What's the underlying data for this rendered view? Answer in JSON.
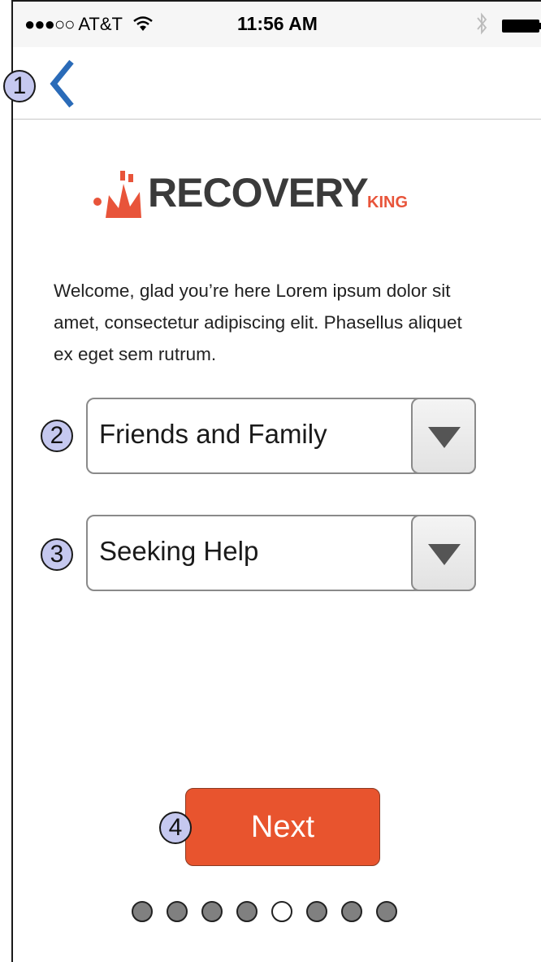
{
  "status_bar": {
    "signal_dots": "●●●○○",
    "carrier": "AT&T",
    "wifi_icon": "wifi-icon",
    "time": "11:56 AM",
    "bluetooth_icon": "bluetooth-icon",
    "battery_icon": "battery-icon"
  },
  "nav": {
    "back_icon": "chevron-left-icon",
    "accent_color": "#2a6bb8",
    "badge": "1"
  },
  "logo": {
    "text": "RECOVERY",
    "subtext": "KING",
    "brand_color": "#e8543a"
  },
  "intro_text": "Welcome, glad you’re here Lorem ipsum dolor sit amet, consectetur adipiscing elit. Phasellus aliquet ex eget sem rutrum.",
  "dropdowns": [
    {
      "badge": "2",
      "value": "Friends and Family"
    },
    {
      "badge": "3",
      "value": "Seeking Help"
    }
  ],
  "next_button": {
    "badge": "4",
    "label": "Next",
    "color": "#e8542e"
  },
  "pager": {
    "total": 8,
    "active_index": 4
  }
}
